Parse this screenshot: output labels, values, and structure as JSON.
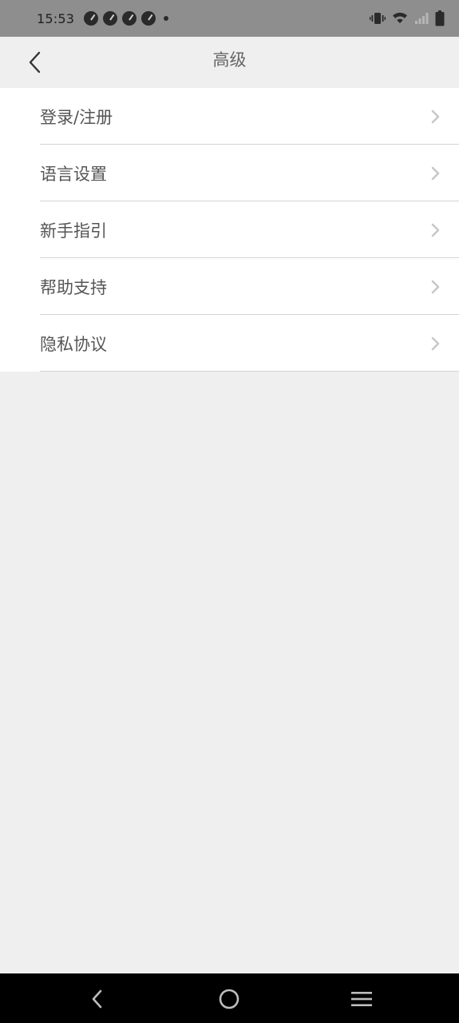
{
  "status_bar": {
    "time": "15:53",
    "notification_icons": [
      "gauge-icon",
      "gauge-icon",
      "gauge-icon",
      "gauge-icon"
    ],
    "right_icons": [
      "vibrate-icon",
      "wifi-icon",
      "signal-icon",
      "battery-icon"
    ]
  },
  "header": {
    "title": "高级"
  },
  "settings": {
    "items": [
      {
        "label": "登录/注册"
      },
      {
        "label": "语言设置"
      },
      {
        "label": "新手指引"
      },
      {
        "label": "帮助支持"
      },
      {
        "label": "隐私协议"
      }
    ]
  },
  "colors": {
    "status_bar_bg": "#8e8e8e",
    "page_bg": "#efefef",
    "list_bg": "#ffffff",
    "text": "#555555",
    "chevron": "#c8c8c8",
    "nav_bar_bg": "#000000"
  }
}
